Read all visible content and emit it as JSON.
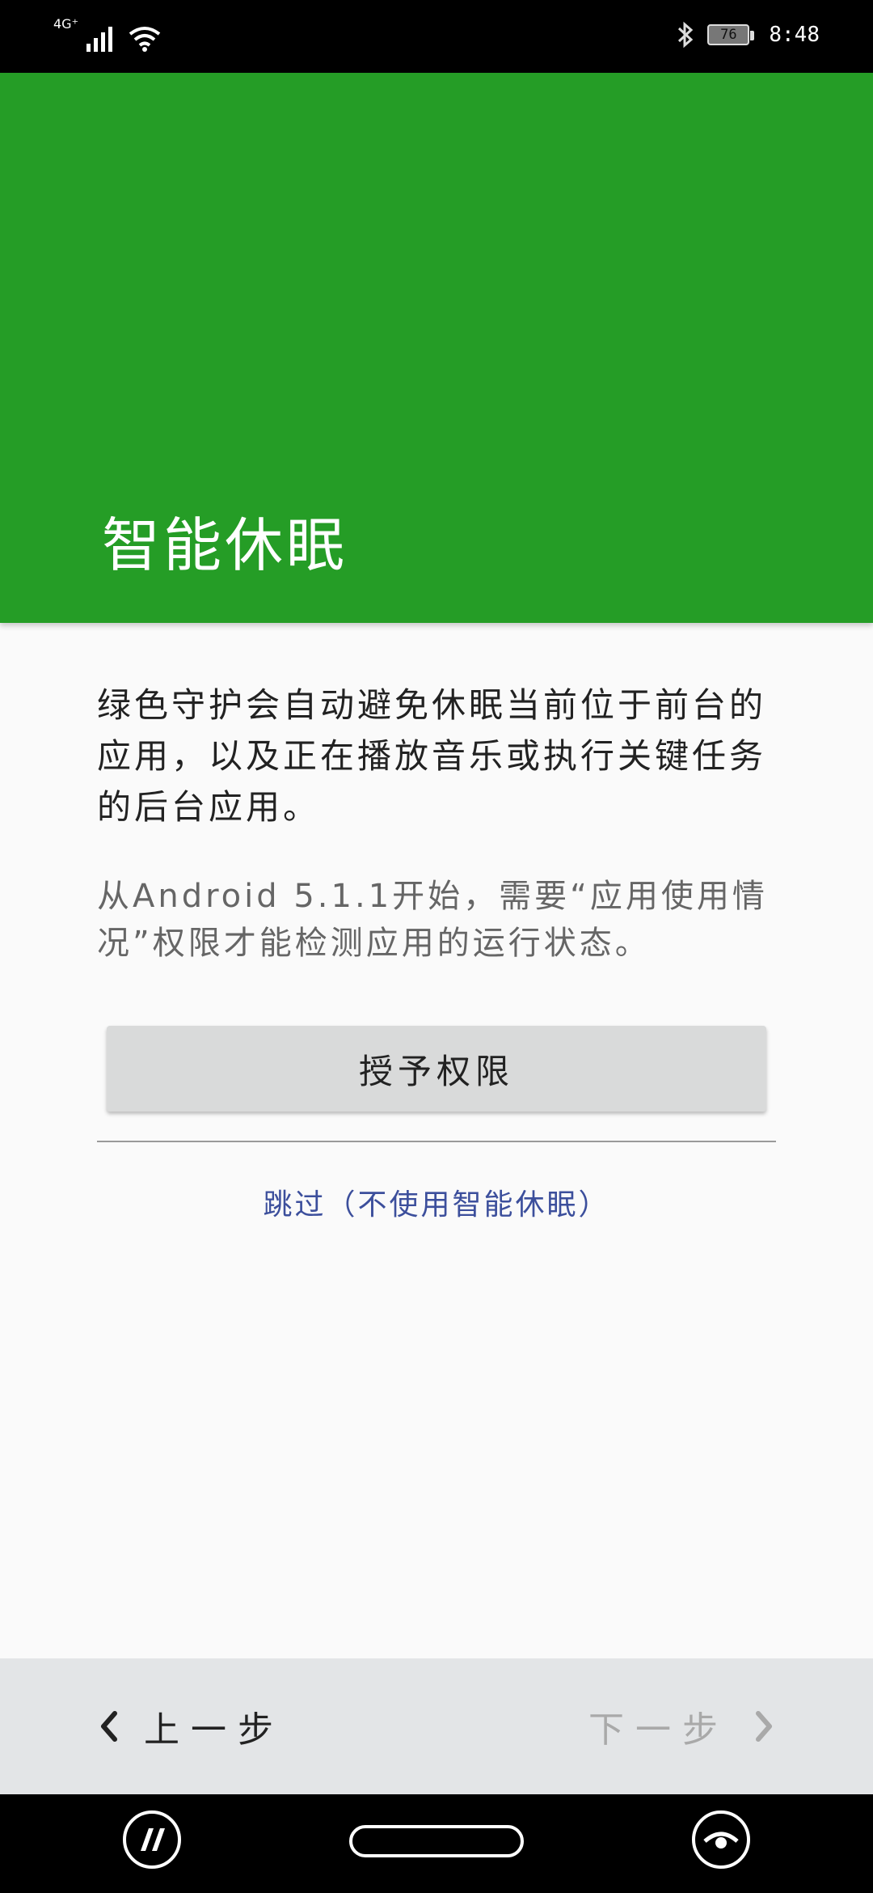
{
  "status_bar": {
    "network": "4G⁺",
    "battery": "76",
    "time": "8:48"
  },
  "header": {
    "title": "智能休眠",
    "color": "#259d26"
  },
  "content": {
    "description": "绿色守护会自动避免休眠当前位于前台的应用，以及正在播放音乐或执行关键任务的后台应用。",
    "note": "从Android 5.1.1开始，需要“应用使用情况”权限才能检测应用的运行状态。"
  },
  "actions": {
    "grant_label": "授予权限",
    "skip_label": "跳过（不使用智能休眠）"
  },
  "steps": {
    "prev_label": "上一步",
    "next_label": "下一步"
  },
  "icons": {
    "wifi": "wifi-icon",
    "bluetooth": "bluetooth-icon",
    "prev": "chevron-left-icon",
    "next": "chevron-right-icon"
  }
}
